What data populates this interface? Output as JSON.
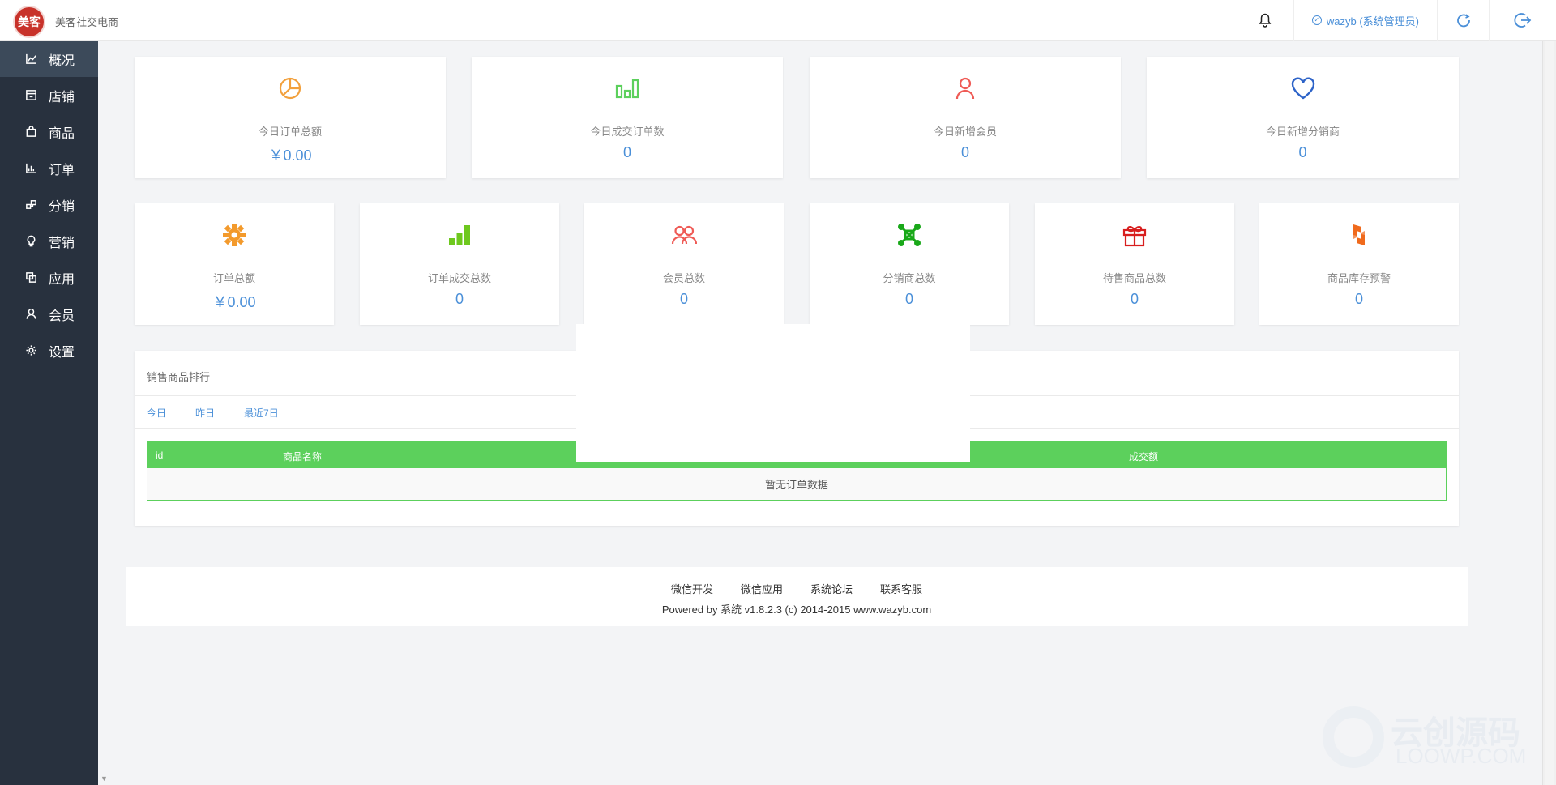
{
  "header": {
    "logo_text": "美客",
    "brand": "美客社交电商",
    "user": "wazyb (系统管理员)"
  },
  "sidebar": {
    "items": [
      {
        "label": "概况",
        "icon": "line-chart-icon"
      },
      {
        "label": "店铺",
        "icon": "store-icon"
      },
      {
        "label": "商品",
        "icon": "shopping-bag-icon"
      },
      {
        "label": "订单",
        "icon": "bar-chart-icon"
      },
      {
        "label": "分销",
        "icon": "distribution-icon"
      },
      {
        "label": "营销",
        "icon": "lightbulb-icon"
      },
      {
        "label": "应用",
        "icon": "apps-icon"
      },
      {
        "label": "会员",
        "icon": "user-icon"
      },
      {
        "label": "设置",
        "icon": "gear-icon"
      }
    ]
  },
  "stats_top": [
    {
      "label": "今日订单总额",
      "value": "￥0.00",
      "icon": "pie-chart-icon",
      "color": "#f2a03c"
    },
    {
      "label": "今日成交订单数",
      "value": "0",
      "icon": "bar-chart-icon",
      "color": "#5cd05c"
    },
    {
      "label": "今日新增会员",
      "value": "0",
      "icon": "user-icon",
      "color": "#ef5b56"
    },
    {
      "label": "今日新增分销商",
      "value": "0",
      "icon": "heart-icon",
      "color": "#2d63c8"
    }
  ],
  "stats_bottom": [
    {
      "label": "订单总额",
      "value": "￥0.00",
      "icon": "cog-icon",
      "color": "#f39a2c"
    },
    {
      "label": "订单成交总数",
      "value": "0",
      "icon": "signal-icon",
      "color": "#6ec81e"
    },
    {
      "label": "会员总数",
      "value": "0",
      "icon": "users-icon",
      "color": "#ef5b56"
    },
    {
      "label": "分销商总数",
      "value": "0",
      "icon": "network-icon",
      "color": "#19a819"
    },
    {
      "label": "待售商品总数",
      "value": "0",
      "icon": "gift-icon",
      "color": "#d81e1e"
    },
    {
      "label": "商品库存预警",
      "value": "0",
      "icon": "stock-warning-icon",
      "color": "#f06a1c"
    }
  ],
  "ranking": {
    "title": "销售商品排行",
    "tabs": [
      "今日",
      "昨日",
      "最近7日"
    ],
    "columns": [
      "id",
      "商品名称",
      "成交额"
    ],
    "empty": "暂无订单数据"
  },
  "footer": {
    "links": [
      "微信开发",
      "微信应用",
      "系统论坛",
      "联系客服"
    ],
    "copyright": "Powered by 系统 v1.8.2.3 (c) 2014-2015 www.wazyb.com"
  },
  "watermark": {
    "line1": "云创源码",
    "line2": "LOOWP.COM"
  },
  "colors": {
    "sidebar_bg": "#28313e",
    "sidebar_active": "#3c4a5a",
    "accent_blue": "#4a8fd8",
    "table_green": "#5cd05c"
  }
}
